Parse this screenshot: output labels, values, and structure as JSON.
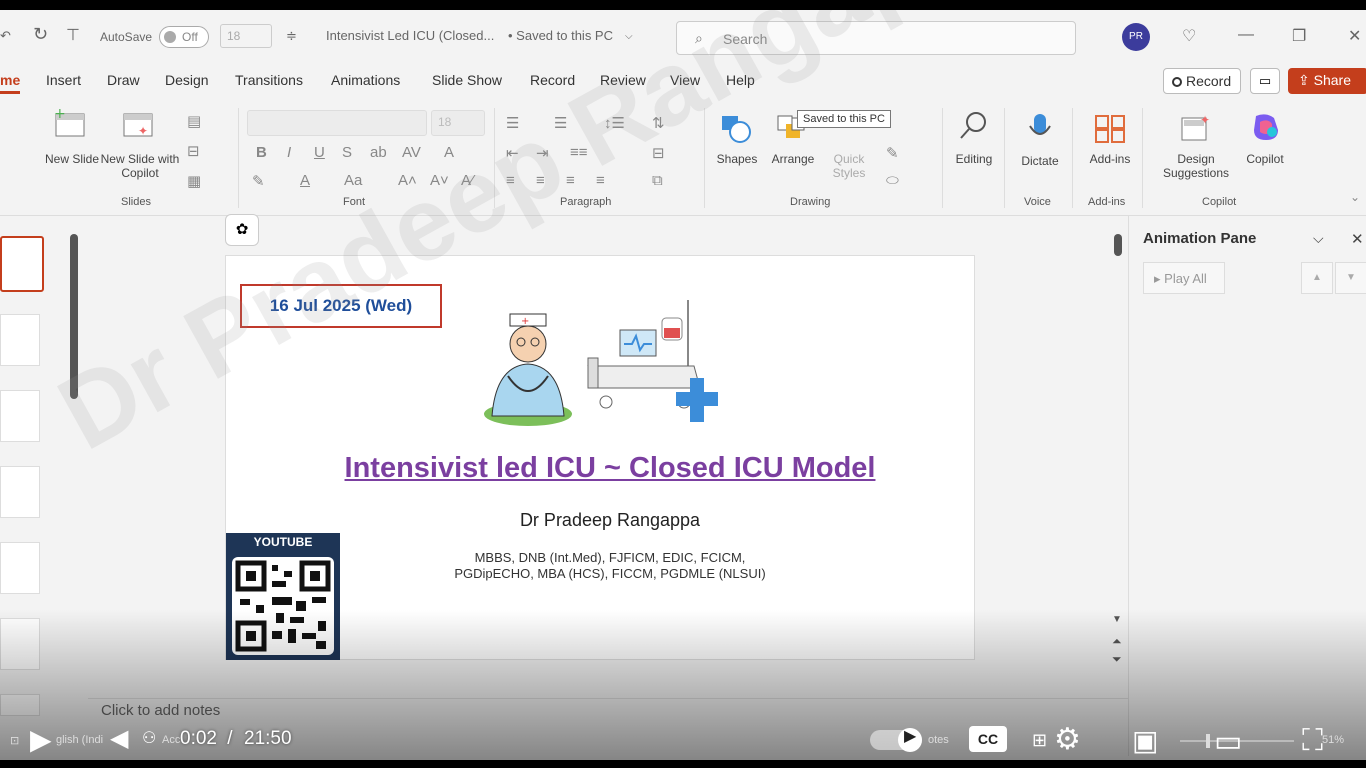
{
  "titlebar": {
    "autosave_label": "AutoSave",
    "autosave_state": "Off",
    "font_size_mini": "18",
    "doc_title": "Intensivist Led ICU (Closed...",
    "saved_state": "• Saved to this PC",
    "search_placeholder": "Search",
    "avatar_initials": "PR"
  },
  "tabs": [
    "me",
    "Insert",
    "Draw",
    "Design",
    "Transitions",
    "Animations",
    "Slide Show",
    "Record",
    "Review",
    "View",
    "Help"
  ],
  "tab_actions": {
    "record": "Record",
    "share": "Share"
  },
  "ribbon": {
    "slides": {
      "new_slide": "New Slide",
      "new_slide_copilot": "New Slide with Copilot",
      "group": "Slides"
    },
    "font": {
      "size": "18",
      "group": "Font"
    },
    "paragraph": {
      "group": "Paragraph"
    },
    "drawing": {
      "shapes": "Shapes",
      "arrange": "Arrange",
      "quick_styles": "Quick Styles",
      "group": "Drawing",
      "tooltip": "Saved to this PC"
    },
    "editing": {
      "label": "Editing"
    },
    "voice": {
      "dictate": "Dictate",
      "group": "Voice"
    },
    "addins": {
      "label": "Add-ins",
      "group": "Add-ins"
    },
    "copilot": {
      "design_suggestions": "Design Suggestions",
      "copilot": "Copilot",
      "group": "Copilot"
    }
  },
  "slide": {
    "date": "16 Jul 2025 (Wed)",
    "title": "Intensivist led ICU ~ Closed ICU Model",
    "author": "Dr Pradeep Rangappa",
    "quals_line1": "MBBS, DNB (Int.Med), FJFICM, EDIC, FCICM,",
    "quals_line2": "PGDipECHO, MBA (HCS), FICCM, PGDMLE (NLSUI)",
    "qr_label": "YOUTUBE"
  },
  "notes_placeholder": "Click to add notes",
  "animation_pane": {
    "title": "Animation Pane",
    "play_all": "Play All"
  },
  "watermark": "Dr Pradeep Rangappa",
  "player": {
    "current_time": "0:02",
    "separator": " / ",
    "duration": "21:50",
    "status_language": "glish (Indi",
    "status_access": "Acc",
    "notes_label": "otes",
    "zoom": "51%"
  },
  "colors": {
    "accent": "#c43e1c",
    "title_purple": "#7b3fa0",
    "date_blue": "#1f4e9a",
    "date_border": "#c0392b",
    "qr_bg": "#1e3556"
  }
}
